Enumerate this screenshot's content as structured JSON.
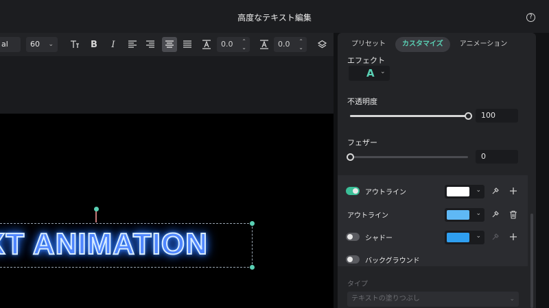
{
  "window": {
    "title": "高度なテキスト編集",
    "help_glyph": "?"
  },
  "toolbar": {
    "font_name": "al",
    "font_size": "60",
    "letter_spacing": "0.0",
    "line_spacing": "0.0"
  },
  "preview": {
    "text": "XT ANIMATION"
  },
  "panel": {
    "tabs": [
      {
        "label": "プリセット"
      },
      {
        "label": "カスタマイズ"
      },
      {
        "label": "アニメーション"
      }
    ],
    "effect": {
      "label": "エフェクト",
      "glyph": "A"
    },
    "opacity": {
      "label": "不透明度",
      "value": "100",
      "fraction": 1.0
    },
    "feather": {
      "label": "フェザー",
      "value": "0",
      "fraction": 0.0
    },
    "outline1": {
      "label": "アウトライン",
      "enabled": true,
      "color": "#ffffff"
    },
    "outline2": {
      "label": "アウトライン",
      "color": "#5fb8f5"
    },
    "shadow": {
      "label": "シャドー",
      "enabled": false,
      "color": "#2f9ff0"
    },
    "background": {
      "label": "バックグラウンド",
      "enabled": false
    },
    "type": {
      "label": "タイプ",
      "value": "テキストの塗りつぶし"
    }
  },
  "colors": {
    "accent": "#5ad0b4",
    "glow": "#3d8bff"
  }
}
